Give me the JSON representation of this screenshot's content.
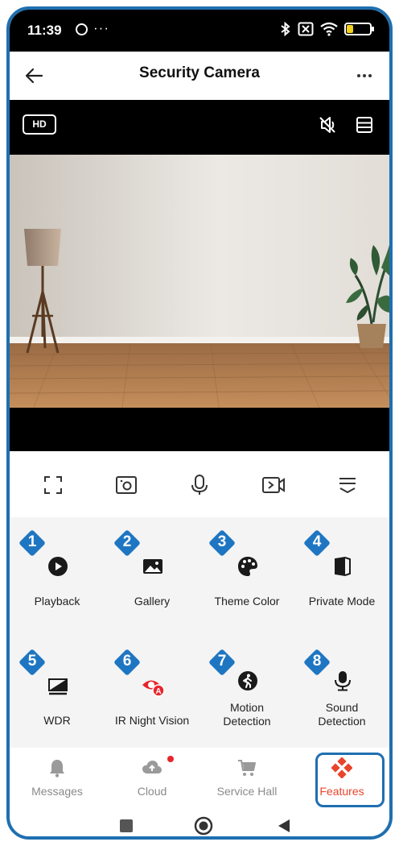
{
  "status_bar": {
    "time": "11:39",
    "more": "···",
    "battery": "9",
    "battery_level": 0.09,
    "icons": [
      "bluetooth-icon",
      "sim-off-icon",
      "wifi-icon",
      "battery-icon"
    ]
  },
  "header": {
    "title": "Security Camera",
    "back_icon": "arrow-left-icon",
    "more_icon": "more-dots-icon"
  },
  "camera": {
    "quality_label": "HD",
    "mute_icon": "speaker-muted-icon",
    "layout_icon": "layout-icon"
  },
  "controls": [
    "fullscreen-icon",
    "snapshot-icon",
    "microphone-icon",
    "record-icon",
    "collapse-menu-icon"
  ],
  "features": [
    {
      "number": "1",
      "label": "Playback",
      "icon": "playback-icon"
    },
    {
      "number": "2",
      "label": "Gallery",
      "icon": "gallery-icon"
    },
    {
      "number": "3",
      "label": "Theme Color",
      "icon": "palette-icon"
    },
    {
      "number": "4",
      "label": "Private Mode",
      "icon": "private-mode-icon"
    },
    {
      "number": "5",
      "label": "WDR",
      "icon": "wdr-icon"
    },
    {
      "number": "6",
      "label": "IR Night Vision",
      "icon": "ir-night-vision-icon"
    },
    {
      "number": "7",
      "label": "Motion Detection",
      "label_line1": "Motion",
      "label_line2": "Detection",
      "icon": "motion-detection-icon"
    },
    {
      "number": "8",
      "label": "Sound Detection",
      "label_line1": "Sound",
      "label_line2": "Detection",
      "icon": "sound-detection-icon"
    }
  ],
  "bottom_nav": [
    {
      "label": "Messages",
      "icon": "bell-icon"
    },
    {
      "label": "Cloud",
      "icon": "cloud-upload-icon",
      "has_notification": true
    },
    {
      "label": "Service Hall",
      "icon": "cart-icon"
    },
    {
      "label": "Features",
      "icon": "features-icon",
      "active": true
    }
  ],
  "colors": {
    "accent_blue": "#1e76c2",
    "active_red": "#e8452c",
    "inactive_gray": "#8a8a8a"
  }
}
